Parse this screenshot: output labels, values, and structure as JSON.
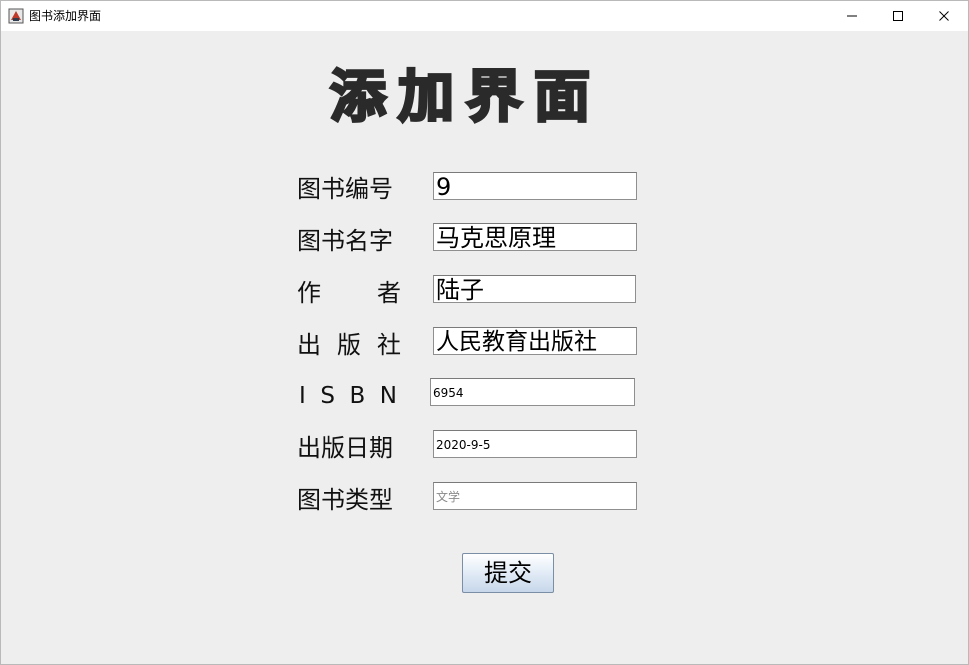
{
  "window": {
    "title": "图书添加界面"
  },
  "heading": "添加界面",
  "form": {
    "fields": [
      {
        "label": "图书编号",
        "value": "9"
      },
      {
        "label_chars": [
          "作",
          "者"
        ],
        "label_a": "作",
        "label_b": "者"
      },
      {}
    ],
    "book_id": {
      "label": "图书编号",
      "value": "9"
    },
    "book_name": {
      "label": "图书名字",
      "value": "马克思原理"
    },
    "author": {
      "label_1": "作",
      "label_2": "者",
      "value": "陆子"
    },
    "publisher": {
      "label_1": "出",
      "label_2": "版",
      "label_3": "社",
      "value": "人民教育出版社"
    },
    "isbn": {
      "label_1": "I",
      "label_2": "S",
      "label_3": "B",
      "label_4": "N",
      "value": "6954"
    },
    "pub_date": {
      "label": "出版日期",
      "value": "2020-9-5"
    },
    "category": {
      "label": "图书类型",
      "placeholder": "文学"
    }
  },
  "submit_label": "提交",
  "colors": {
    "background": "#eeeeee",
    "heading": "#2a2a2a",
    "button_top": "#ffffff",
    "button_bottom": "#c7d7ea"
  }
}
